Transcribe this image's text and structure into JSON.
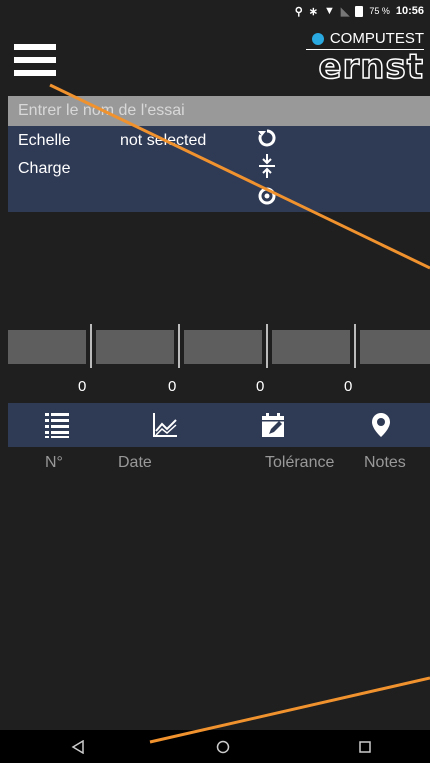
{
  "status": {
    "icons": [
      "location-icon",
      "bluetooth-icon",
      "wifi-icon",
      "no-signal-icon",
      "battery-icon"
    ],
    "battery_pct": "75 %",
    "time": "10:56"
  },
  "brand": {
    "name": "COMPUTEST",
    "logo": "ernst",
    "accent_color": "#29a9e0"
  },
  "search": {
    "placeholder": "Entrer le nom de l'essai"
  },
  "info": {
    "scale_label": "Echelle",
    "scale_value": "not selected",
    "load_label": "Charge"
  },
  "gauge": {
    "values": [
      "0",
      "0",
      "0",
      "0"
    ]
  },
  "toolbar": {
    "items": [
      "list-icon",
      "chart-icon",
      "calendar-icon",
      "location-pin-icon"
    ]
  },
  "columns": {
    "labels": [
      "N°",
      "Date",
      "Tolérance",
      "Notes"
    ]
  },
  "colors": {
    "panel": "#2f3a55",
    "annotation": "#f0922e"
  }
}
